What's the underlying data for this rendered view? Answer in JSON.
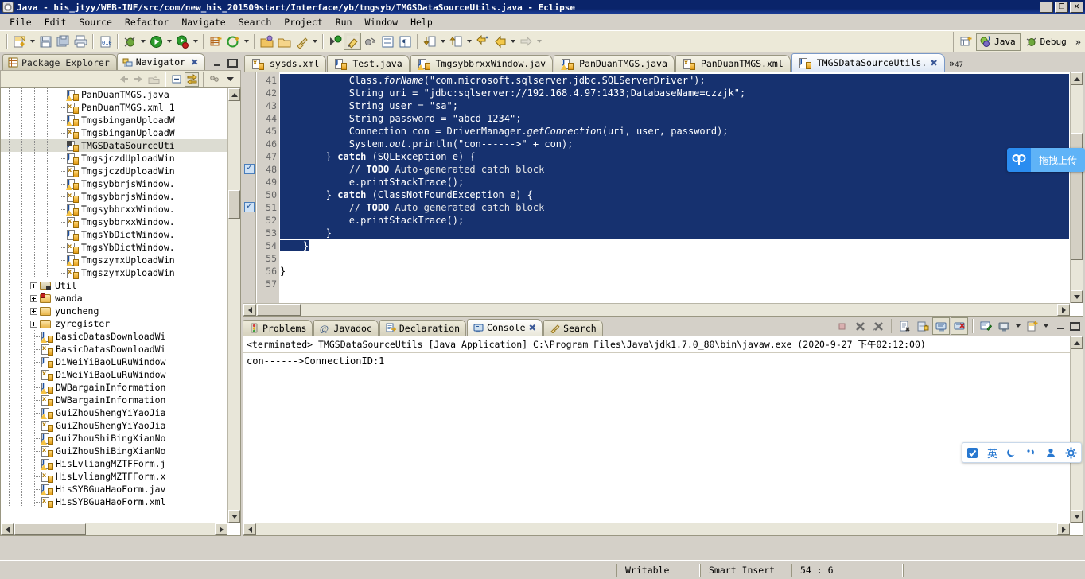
{
  "window": {
    "title": "Java - his_jtyy/WEB-INF/src/com/new_his_201509start/Interface/yb/tmgsyb/TMGSDataSourceUtils.java - Eclipse",
    "minimize": "_",
    "maximize": "❐",
    "close": "✕"
  },
  "menu": {
    "items": [
      "File",
      "Edit",
      "Source",
      "Refactor",
      "Navigate",
      "Search",
      "Project",
      "Run",
      "Window",
      "Help"
    ]
  },
  "toolbar": {
    "perspective_java": "Java",
    "perspective_debug": "Debug",
    "overflow": "»"
  },
  "left_view": {
    "tabs": [
      {
        "label": "Package Explorer",
        "active": false,
        "icon": "package-explorer-icon"
      },
      {
        "label": "Navigator",
        "active": true,
        "icon": "navigator-icon",
        "close": "✖"
      }
    ],
    "tree": [
      {
        "label": "PanDuanTMGS.java",
        "icon": "java-warn",
        "depth": 5,
        "selected": false
      },
      {
        "label": "PanDuanTMGS.xml 1",
        "icon": "xml",
        "depth": 5,
        "selected": false
      },
      {
        "label": "TmgsbinganUploadW",
        "icon": "java-warn",
        "depth": 5,
        "selected": false
      },
      {
        "label": "TmgsbinganUploadW",
        "icon": "xml",
        "depth": 5,
        "selected": false
      },
      {
        "label": "TMGSDataSourceUti",
        "icon": "java-sel",
        "depth": 5,
        "selected": true
      },
      {
        "label": "TmgsjczdUploadWin",
        "icon": "java",
        "depth": 5,
        "selected": false
      },
      {
        "label": "TmgsjczdUploadWin",
        "icon": "xml",
        "depth": 5,
        "selected": false
      },
      {
        "label": "TmgsybbrjsWindow.",
        "icon": "java-warn",
        "depth": 5,
        "selected": false
      },
      {
        "label": "TmgsybbrjsWindow.",
        "icon": "xml",
        "depth": 5,
        "selected": false
      },
      {
        "label": "TmgsybbrxxWindow.",
        "icon": "java-warn",
        "depth": 5,
        "selected": false
      },
      {
        "label": "TmgsybbrxxWindow.",
        "icon": "xml",
        "depth": 5,
        "selected": false
      },
      {
        "label": "TmgsYbDictWindow.",
        "icon": "java",
        "depth": 5,
        "selected": false
      },
      {
        "label": "TmgsYbDictWindow.",
        "icon": "xml",
        "depth": 5,
        "selected": false
      },
      {
        "label": "TmgszymxUploadWin",
        "icon": "java-warn",
        "depth": 5,
        "selected": false
      },
      {
        "label": "TmgszymxUploadWin",
        "icon": "xml",
        "depth": 5,
        "selected": false
      },
      {
        "label": "Util",
        "icon": "folder-pkg",
        "depth": 2,
        "selected": false,
        "expander": true
      },
      {
        "label": "wanda",
        "icon": "folder-x",
        "depth": 2,
        "selected": false,
        "expander": true
      },
      {
        "label": "yuncheng",
        "icon": "folder",
        "depth": 2,
        "selected": false,
        "expander": true
      },
      {
        "label": "zyregister",
        "icon": "folder",
        "depth": 2,
        "selected": false,
        "expander": true
      },
      {
        "label": "BasicDatasDownloadWi",
        "icon": "java-warn",
        "depth": 3,
        "selected": false
      },
      {
        "label": "BasicDatasDownloadWi",
        "icon": "xml",
        "depth": 3,
        "selected": false
      },
      {
        "label": "DiWeiYiBaoLuRuWindow",
        "icon": "java",
        "depth": 3,
        "selected": false
      },
      {
        "label": "DiWeiYiBaoLuRuWindow",
        "icon": "xml",
        "depth": 3,
        "selected": false
      },
      {
        "label": "DWBargainInformation",
        "icon": "java-warn",
        "depth": 3,
        "selected": false
      },
      {
        "label": "DWBargainInformation",
        "icon": "xml",
        "depth": 3,
        "selected": false
      },
      {
        "label": "GuiZhouShengYiYaoJia",
        "icon": "java-warn",
        "depth": 3,
        "selected": false
      },
      {
        "label": "GuiZhouShengYiYaoJia",
        "icon": "xml",
        "depth": 3,
        "selected": false
      },
      {
        "label": "GuiZhouShiBingXianNo",
        "icon": "java-warn",
        "depth": 3,
        "selected": false
      },
      {
        "label": "GuiZhouShiBingXianNo",
        "icon": "xml",
        "depth": 3,
        "selected": false
      },
      {
        "label": "HisLvliangMZTFForm.j",
        "icon": "java-warn",
        "depth": 3,
        "selected": false
      },
      {
        "label": "HisLvliangMZTFForm.x",
        "icon": "xml",
        "depth": 3,
        "selected": false
      },
      {
        "label": "HisSYBGuaHaoForm.jav",
        "icon": "java-warn",
        "depth": 3,
        "selected": false
      },
      {
        "label": "HisSYBGuaHaoForm.xml",
        "icon": "xml",
        "depth": 3,
        "selected": false
      }
    ]
  },
  "editor": {
    "tabs": [
      {
        "label": "sysds.xml",
        "icon": "xml",
        "active": false
      },
      {
        "label": "Test.java",
        "icon": "java",
        "active": false
      },
      {
        "label": "TmgsybbrxxWindow.jav",
        "icon": "java-warn",
        "active": false
      },
      {
        "label": "PanDuanTMGS.java",
        "icon": "java-warn",
        "active": false
      },
      {
        "label": "PanDuanTMGS.xml",
        "icon": "xml",
        "active": false
      },
      {
        "label": "TMGSDataSourceUtils.",
        "icon": "java",
        "active": true,
        "close": "✖"
      }
    ],
    "hidden_tabs_marker": "»",
    "hidden_tabs_count": "47",
    "lines": [
      {
        "no": "41",
        "selected": true,
        "bookmark": false,
        "tokens": [
          {
            "t": "            Class.",
            "c": ""
          },
          {
            "t": "forName",
            "c": "it"
          },
          {
            "t": "(\"com.microsoft.sqlserver.jdbc.SQLServerDriver\");",
            "c": ""
          }
        ]
      },
      {
        "no": "42",
        "selected": true,
        "bookmark": false,
        "tokens": [
          {
            "t": "            String uri = \"jdbc:sqlserver://192.168.4.97:1433;DatabaseName=czzjk\";",
            "c": ""
          }
        ]
      },
      {
        "no": "43",
        "selected": true,
        "bookmark": false,
        "tokens": [
          {
            "t": "            String user = \"sa\";",
            "c": ""
          }
        ]
      },
      {
        "no": "44",
        "selected": true,
        "bookmark": false,
        "tokens": [
          {
            "t": "            String password = \"abcd-1234\";",
            "c": ""
          }
        ]
      },
      {
        "no": "45",
        "selected": true,
        "bookmark": false,
        "tokens": [
          {
            "t": "            Connection con = DriverManager.",
            "c": ""
          },
          {
            "t": "getConnection",
            "c": "it"
          },
          {
            "t": "(uri, user, password);",
            "c": ""
          }
        ]
      },
      {
        "no": "46",
        "selected": true,
        "bookmark": false,
        "tokens": [
          {
            "t": "            System.",
            "c": ""
          },
          {
            "t": "out",
            "c": "it"
          },
          {
            "t": ".println(\"con------>\" + con);",
            "c": ""
          }
        ]
      },
      {
        "no": "47",
        "selected": true,
        "bookmark": false,
        "tokens": [
          {
            "t": "        } ",
            "c": ""
          },
          {
            "t": "catch",
            "c": "td"
          },
          {
            "t": " (SQLException e) {",
            "c": ""
          }
        ]
      },
      {
        "no": "48",
        "selected": true,
        "bookmark": true,
        "tokens": [
          {
            "t": "            // ",
            "c": "cm"
          },
          {
            "t": "TODO",
            "c": "td"
          },
          {
            "t": " Auto-generated catch block",
            "c": "cm"
          }
        ]
      },
      {
        "no": "49",
        "selected": true,
        "bookmark": false,
        "tokens": [
          {
            "t": "            e.printStackTrace();",
            "c": ""
          }
        ]
      },
      {
        "no": "50",
        "selected": true,
        "bookmark": false,
        "tokens": [
          {
            "t": "        } ",
            "c": ""
          },
          {
            "t": "catch",
            "c": "td"
          },
          {
            "t": " (ClassNotFoundException e) {",
            "c": ""
          }
        ]
      },
      {
        "no": "51",
        "selected": true,
        "bookmark": true,
        "tokens": [
          {
            "t": "            // ",
            "c": "cm"
          },
          {
            "t": "TODO",
            "c": "td"
          },
          {
            "t": " Auto-generated catch block",
            "c": "cm"
          }
        ]
      },
      {
        "no": "52",
        "selected": true,
        "bookmark": false,
        "tokens": [
          {
            "t": "            e.printStackTrace();",
            "c": ""
          }
        ]
      },
      {
        "no": "53",
        "selected": true,
        "bookmark": false,
        "tokens": [
          {
            "t": "        }",
            "c": ""
          }
        ]
      },
      {
        "no": "54",
        "selected": "partial",
        "bookmark": false,
        "tokens": [
          {
            "t": "    }",
            "c": ""
          }
        ]
      },
      {
        "no": "55",
        "selected": false,
        "bookmark": false,
        "tokens": [
          {
            "t": "",
            "c": ""
          }
        ]
      },
      {
        "no": "56",
        "selected": false,
        "bookmark": false,
        "tokens": [
          {
            "t": "}",
            "c": ""
          }
        ]
      },
      {
        "no": "57",
        "selected": false,
        "bookmark": false,
        "tokens": [
          {
            "t": "",
            "c": ""
          }
        ]
      }
    ]
  },
  "bottom_view": {
    "tabs": [
      {
        "label": "Problems",
        "icon": "problems-icon",
        "active": false
      },
      {
        "label": "Javadoc",
        "icon": "javadoc-icon",
        "active": false
      },
      {
        "label": "Declaration",
        "icon": "declaration-icon",
        "active": false
      },
      {
        "label": "Console",
        "icon": "console-icon",
        "active": true,
        "close": "✖"
      },
      {
        "label": "Search",
        "icon": "search-icon",
        "active": false
      }
    ],
    "console_header": "<terminated> TMGSDataSourceUtils [Java Application] C:\\Program Files\\Java\\jdk1.7.0_80\\bin\\javaw.exe (2020-9-27 下午02:12:00)",
    "console_output": "con------>ConnectionID:1"
  },
  "statusbar": {
    "writable": "Writable",
    "insert_mode": "Smart Insert",
    "position": "54 : 6"
  },
  "overlays": {
    "baidu_netdisk_label": "拖拽上传",
    "ime_items": [
      "✓",
      "英",
      "☾",
      "’",
      "●",
      "⚙"
    ]
  },
  "colors": {
    "title_bar": "#0a246a",
    "chrome": "#d4d0c8",
    "selection": "#16316f",
    "accent_blue": "#2a8cf0"
  }
}
